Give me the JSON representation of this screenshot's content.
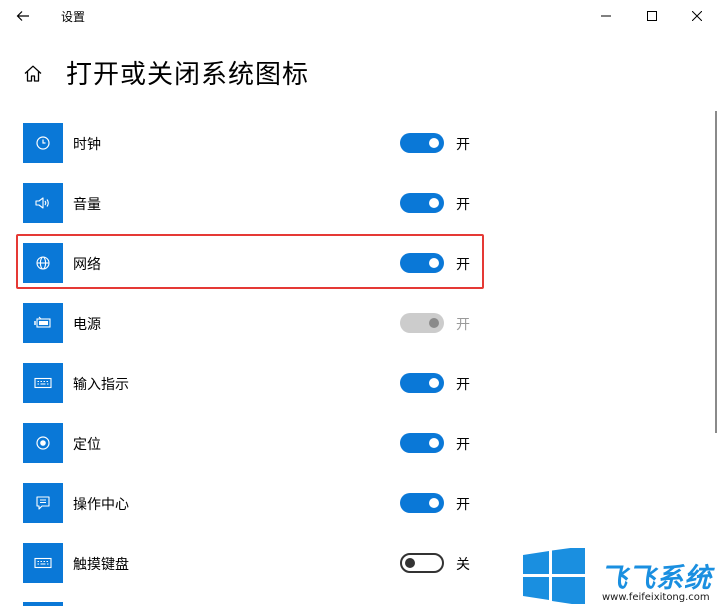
{
  "window": {
    "title": "设置"
  },
  "page": {
    "title": "打开或关闭系统图标"
  },
  "colors": {
    "accent": "#0a78d7",
    "highlight_border": "#e53935",
    "watermark_blue": "#1a8fe0"
  },
  "items": [
    {
      "label": "时钟",
      "state": "开",
      "icon": "clock-icon",
      "toggle": "on"
    },
    {
      "label": "音量",
      "state": "开",
      "icon": "volume-icon",
      "toggle": "on"
    },
    {
      "label": "网络",
      "state": "开",
      "icon": "globe-icon",
      "toggle": "on",
      "highlighted": true
    },
    {
      "label": "电源",
      "state": "开",
      "icon": "battery-icon",
      "toggle": "disabled"
    },
    {
      "label": "输入指示",
      "state": "开",
      "icon": "keyboard-icon",
      "toggle": "on"
    },
    {
      "label": "定位",
      "state": "开",
      "icon": "location-icon",
      "toggle": "on"
    },
    {
      "label": "操作中心",
      "state": "开",
      "icon": "action-center-icon",
      "toggle": "on"
    },
    {
      "label": "触摸键盘",
      "state": "关",
      "icon": "touch-keyboard-icon",
      "toggle": "off"
    }
  ],
  "watermark": {
    "brand": "飞飞系统",
    "url": "www.feifeixitong.com"
  }
}
